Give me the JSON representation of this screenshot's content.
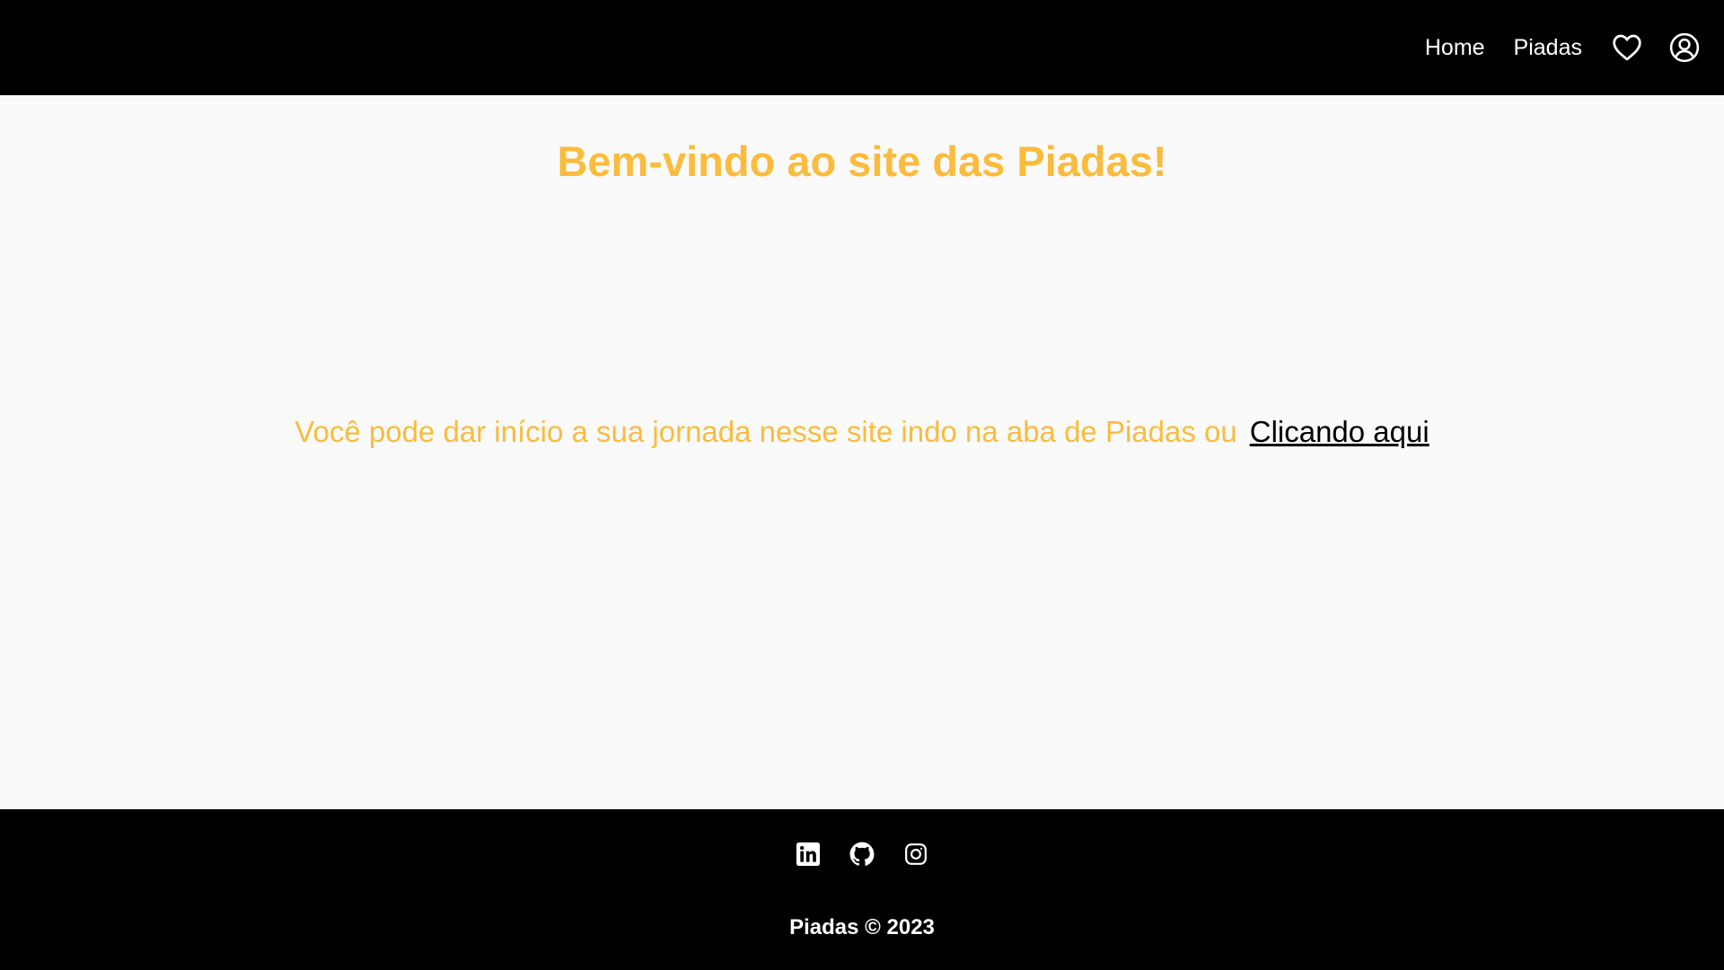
{
  "header": {
    "nav": {
      "home_label": "Home",
      "piadas_label": "Piadas"
    },
    "icons": [
      "heart-icon",
      "user-circle-icon"
    ]
  },
  "main": {
    "title": "Bem-vindo ao site das Piadas!",
    "intro_text": "Você pode dar início a sua jornada nesse site indo na aba de Piadas ou",
    "intro_link": "Clicando aqui"
  },
  "footer": {
    "social_icons": [
      "linkedin-icon",
      "github-icon",
      "instagram-icon"
    ],
    "copyright": "Piadas © 2023"
  },
  "colors": {
    "accent": "#fbbb3c",
    "header_bg": "#000000",
    "page_bg": "#fafafa"
  }
}
